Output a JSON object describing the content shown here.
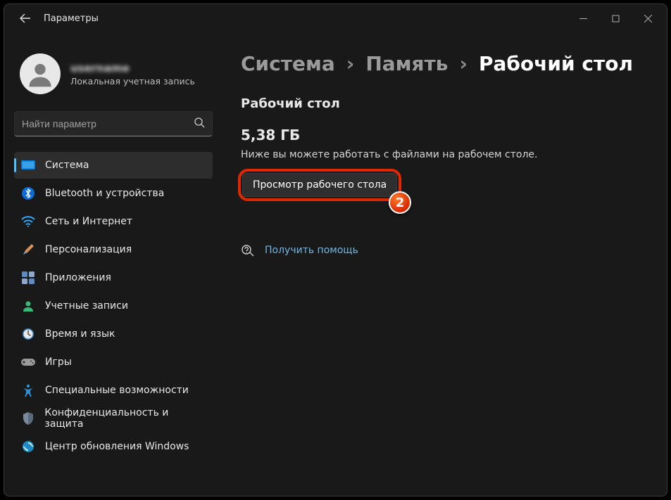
{
  "window": {
    "title": "Параметры"
  },
  "profile": {
    "name": "username",
    "sub": "Локальная учетная запись"
  },
  "search": {
    "placeholder": "Найти параметр"
  },
  "nav": {
    "system": "Система",
    "bluetooth": "Bluetooth и устройства",
    "network": "Сеть и Интернет",
    "personalization": "Персонализация",
    "apps": "Приложения",
    "accounts": "Учетные записи",
    "time": "Время и язык",
    "gaming": "Игры",
    "accessibility": "Специальные возможности",
    "privacy": "Конфиденциальность и защита",
    "update": "Центр обновления Windows"
  },
  "breadcrumb": {
    "l1": "Система",
    "l2": "Память",
    "l3": "Рабочий стол",
    "sep": "›"
  },
  "main": {
    "section_title": "Рабочий стол",
    "size": "5,38 ГБ",
    "desc": "Ниже вы можете работать с файлами на рабочем столе.",
    "view_button": "Просмотр рабочего стола",
    "help_link": "Получить помощь"
  },
  "annotation": {
    "badge": "2"
  }
}
